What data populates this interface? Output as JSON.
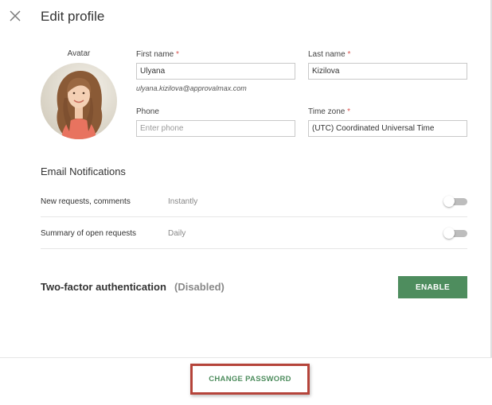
{
  "header": {
    "title": "Edit profile",
    "close_icon": "close-icon"
  },
  "avatar": {
    "label": "Avatar",
    "icon": "user-photo"
  },
  "form": {
    "first_name": {
      "label": "First name",
      "required_mark": "*",
      "value": "Ulyana"
    },
    "email": "ulyana.kizilova@approvalmax.com",
    "last_name": {
      "label": "Last name",
      "required_mark": "*",
      "value": "Kizilova"
    },
    "phone": {
      "label": "Phone",
      "value": "",
      "placeholder": "Enter phone"
    },
    "time_zone": {
      "label": "Time zone",
      "required_mark": "*",
      "value": "(UTC) Coordinated Universal Time"
    }
  },
  "notifications": {
    "title": "Email Notifications",
    "rows": [
      {
        "label": "New requests, comments",
        "value": "Instantly",
        "enabled": false
      },
      {
        "label": "Summary of open requests",
        "value": "Daily",
        "enabled": false
      }
    ]
  },
  "two_factor": {
    "title": "Two-factor authentication",
    "status": "(Disabled)",
    "button": "ENABLE"
  },
  "footer": {
    "change_password": "CHANGE PASSWORD"
  },
  "colors": {
    "accent_green": "#4e8d5e",
    "required_red": "#d9534f",
    "highlight_border": "#b5443a"
  }
}
